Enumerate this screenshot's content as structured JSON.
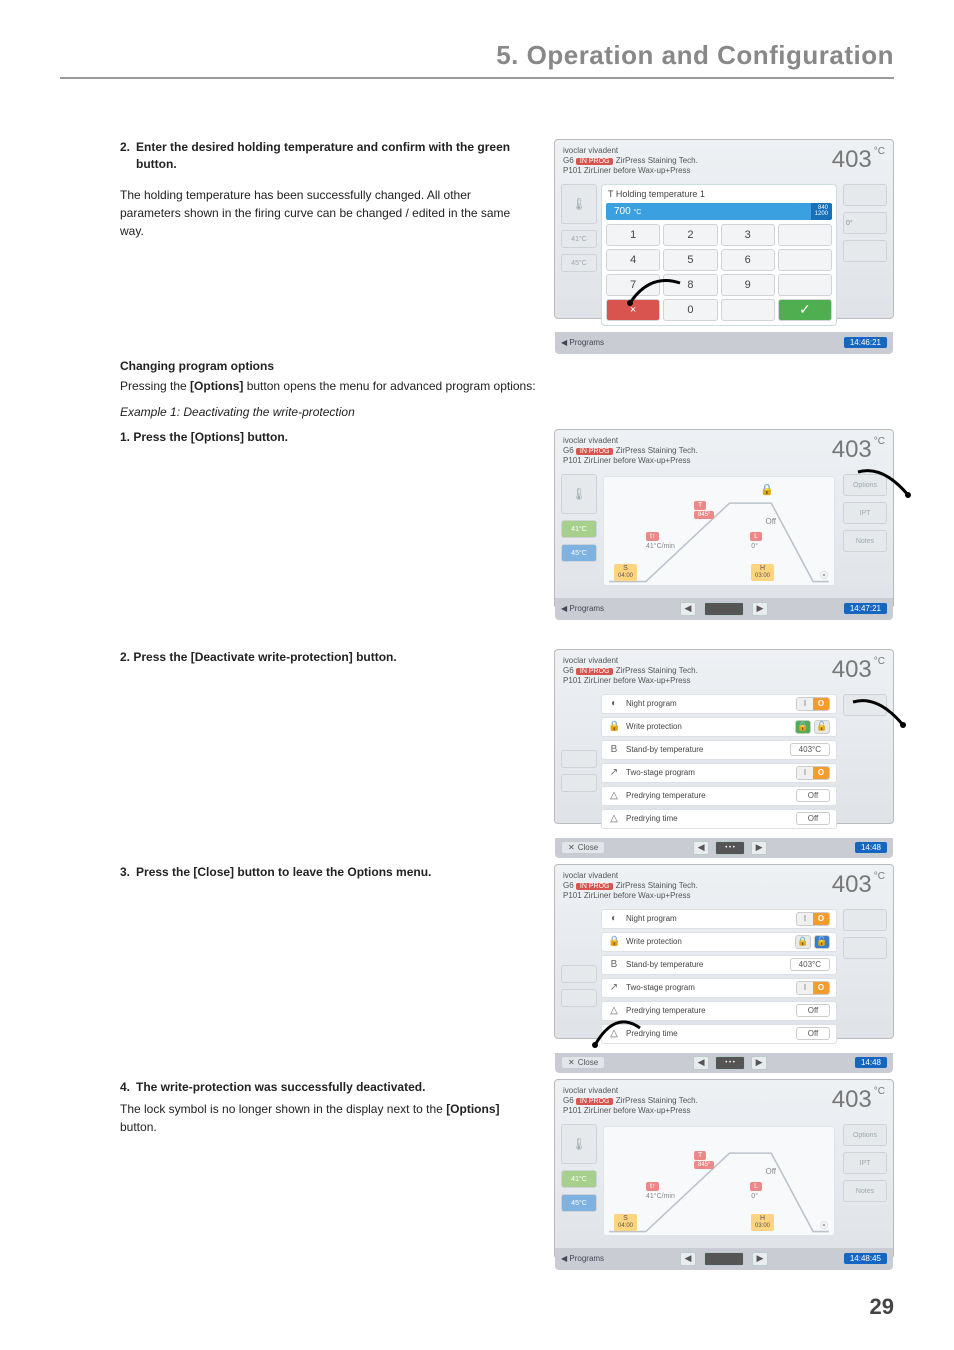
{
  "chapter_title": "5. Operation and Configuration",
  "page_number": "29",
  "step2_heading_prefix": "2.",
  "step2_heading_text": "Enter the desired holding temperature and confirm with the green button.",
  "step2_body": "The holding temperature has been successfully changed. All other parameters shown in the firing curve can be changed / edited in the same way.",
  "changing_options_head": "Changing program options",
  "changing_options_body_a": "Pressing the ",
  "changing_options_body_b": "[Options]",
  "changing_options_body_c": " button opens the menu for advanced program options:",
  "example1": "Example 1: Deactivating the write-protection",
  "opt_step1": "1. Press the [Options] button.",
  "opt_step2": "2. Press the [Deactivate write-protection] button.",
  "opt_step3_prefix": "3.",
  "opt_step3_text": "Press the [Close] button to leave the Options menu.",
  "opt_step4_prefix": "4.",
  "opt_step4_head": "The write-protection was successfully deactivated.",
  "opt_step4_body_a": "The lock symbol is no longer shown in the display next to the ",
  "opt_step4_body_b": "[Options]",
  "opt_step4_body_c": " button.",
  "shot_common": {
    "brand": "ivoclar vivadent",
    "prog_prefix": "G6",
    "prog_label_red": "IN PROG",
    "prog_name": "ZirPress Staining Tech.",
    "prog_line2": "P101 ZirLiner before Wax-up+Press",
    "temp_value": "403",
    "temp_unit": "°C",
    "foot_programs": "Programs",
    "side_vals": {
      "a": "41°C",
      "b": "45°C"
    }
  },
  "shot_keypad": {
    "panel_title": "T  Holding temperature 1",
    "input_value": "700",
    "deg": "°C",
    "limit_lo": "840",
    "limit_hi": "1200",
    "keys": [
      "1",
      "2",
      "3",
      "",
      "4",
      "5",
      "6",
      "",
      "7",
      "8",
      "9",
      "",
      "×",
      "0",
      "",
      "✓"
    ],
    "foot_time": "14:46:21"
  },
  "shot_curve_locked": {
    "chip_top": "T",
    "chip_top_val": "845°",
    "chip_mid": "t↑",
    "chip_mid_val": "41°C/min",
    "chip_r_top": "L",
    "chip_r_bot": "0°",
    "bottom_left_top": "S",
    "bottom_left_bot": "04:00",
    "bottom_right_top": "H",
    "bottom_right_bot": "03:00",
    "off": "Off",
    "lock": "🔒",
    "right_labels": [
      "Options",
      "IPT",
      "Notes"
    ],
    "foot_time": "14:47:21"
  },
  "shot_curve_unlocked": {
    "off": "Off",
    "right_labels": [
      "Options",
      "IPT",
      "Notes"
    ],
    "foot_time": "14:48:45"
  },
  "options_list": {
    "rows": [
      {
        "ico": "◐",
        "label": "Night program",
        "ctrl_type": "pill_io"
      },
      {
        "ico": "🔒",
        "label": "Write protection",
        "ctrl_type": "lock_open"
      },
      {
        "ico": "B",
        "label": "Stand-by temperature",
        "ctrl_type": "val",
        "val": "403°C"
      },
      {
        "ico": "↗",
        "label": "Two-stage program",
        "ctrl_type": "pill_io"
      },
      {
        "ico": "△",
        "label": "Predrying temperature",
        "ctrl_type": "val",
        "val": "Off"
      },
      {
        "ico": "△",
        "label": "Predrying time",
        "ctrl_type": "val",
        "val": "Off"
      }
    ],
    "close": "Close",
    "foot_time_a": "14:48",
    "foot_time_b": "14:48"
  }
}
